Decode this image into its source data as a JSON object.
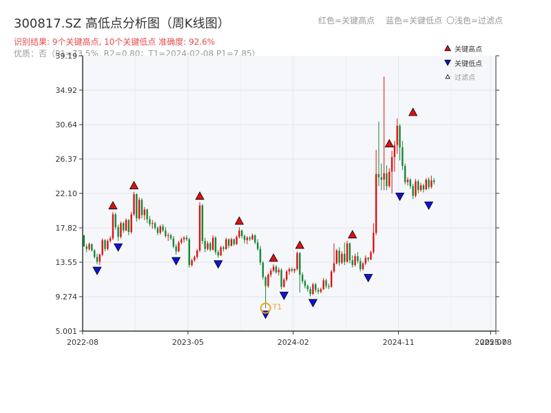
{
  "header": {
    "title": "300817.SZ 高低点分析图（周K线图）",
    "subtitle": "识别结果: 9个关键高点, 10个关键低点  准确度: 92.6%",
    "subtitle2": "优质：否（P1=73.5%, R2=0.80；T1=2024-02-08 P1=7.85）"
  },
  "top_legend": {
    "high_label": "红色=关键高点",
    "low_label": "蓝色=关键低点",
    "filtered_label": "〇浅色=过滤点"
  },
  "chart_data": {
    "type": "candlestick",
    "y_ticks": [
      "5.001",
      "9.274",
      "13.55",
      "17.82",
      "22.10",
      "26.37",
      "30.64",
      "34.92",
      "39.19"
    ],
    "ylim": [
      5.001,
      39.19
    ],
    "x_ticks": [
      {
        "date": "2022-08",
        "week": 0
      },
      {
        "date": "2023-05",
        "week": 40
      },
      {
        "date": "2024-02",
        "week": 80
      },
      {
        "date": "2024-11",
        "week": 120
      },
      {
        "date": "2025-07",
        "week": 155
      },
      {
        "date": "2025-08",
        "week": 157
      }
    ],
    "legend": [
      {
        "label": "关键高点",
        "color": "#dd1111",
        "shape": "up"
      },
      {
        "label": "关键低点",
        "color": "#1111dd",
        "shape": "down"
      },
      {
        "label": "过滤点",
        "color": "#ffffff",
        "shape": "up-small"
      }
    ],
    "candles_ohlc": [
      [
        16.9,
        16.9,
        15.5,
        15.5
      ],
      [
        15.5,
        15.8,
        14.8,
        15.2
      ],
      [
        15.2,
        16.0,
        15.0,
        15.8
      ],
      [
        15.8,
        15.9,
        14.9,
        15.0
      ],
      [
        15.0,
        15.2,
        14.0,
        14.2
      ],
      [
        14.2,
        14.6,
        13.3,
        13.6
      ],
      [
        13.6,
        14.6,
        13.2,
        14.5
      ],
      [
        14.5,
        16.5,
        14.3,
        16.3
      ],
      [
        16.3,
        16.4,
        14.9,
        15.2
      ],
      [
        15.2,
        16.4,
        15.0,
        16.2
      ],
      [
        16.2,
        16.8,
        16.0,
        16.5
      ],
      [
        16.5,
        19.8,
        16.3,
        19.5
      ],
      [
        19.5,
        19.7,
        17.6,
        17.9
      ],
      [
        17.9,
        18.2,
        16.2,
        16.7
      ],
      [
        16.7,
        18.6,
        16.5,
        18.4
      ],
      [
        18.4,
        18.6,
        17.2,
        17.5
      ],
      [
        17.5,
        19.0,
        17.4,
        18.8
      ],
      [
        18.8,
        18.9,
        16.9,
        17.3
      ],
      [
        17.3,
        19.8,
        17.1,
        19.5
      ],
      [
        19.5,
        22.3,
        19.3,
        22.0
      ],
      [
        22.0,
        22.1,
        18.6,
        19.0
      ],
      [
        19.0,
        21.6,
        18.8,
        21.3
      ],
      [
        21.3,
        21.5,
        19.0,
        19.4
      ],
      [
        19.4,
        20.4,
        18.8,
        20.1
      ],
      [
        20.1,
        20.2,
        18.4,
        18.9
      ],
      [
        18.9,
        19.3,
        18.0,
        18.3
      ],
      [
        18.3,
        18.8,
        17.7,
        18.4
      ],
      [
        18.4,
        18.6,
        17.6,
        17.8
      ],
      [
        17.8,
        18.0,
        16.9,
        17.2
      ],
      [
        17.2,
        18.2,
        17.0,
        18.0
      ],
      [
        18.0,
        18.3,
        17.3,
        17.5
      ],
      [
        17.5,
        17.9,
        16.6,
        16.8
      ],
      [
        16.8,
        17.2,
        16.2,
        16.9
      ],
      [
        16.9,
        17.1,
        16.3,
        16.5
      ],
      [
        16.5,
        16.8,
        15.3,
        15.5
      ],
      [
        15.5,
        15.8,
        14.5,
        14.9
      ],
      [
        14.9,
        16.2,
        14.8,
        16.0
      ],
      [
        16.0,
        16.6,
        15.8,
        16.4
      ],
      [
        16.4,
        16.8,
        16.0,
        16.6
      ],
      [
        16.6,
        16.9,
        16.2,
        16.4
      ],
      [
        16.4,
        16.6,
        12.9,
        13.2
      ],
      [
        13.2,
        14.0,
        13.0,
        13.8
      ],
      [
        13.8,
        14.4,
        13.6,
        14.2
      ],
      [
        14.2,
        15.2,
        14.0,
        15.0
      ],
      [
        15.0,
        21.0,
        14.8,
        20.6
      ],
      [
        20.6,
        20.8,
        15.8,
        16.2
      ],
      [
        16.2,
        16.6,
        14.8,
        15.2
      ],
      [
        15.2,
        16.2,
        15.0,
        15.9
      ],
      [
        15.9,
        16.1,
        14.9,
        15.1
      ],
      [
        15.1,
        16.9,
        15.0,
        16.6
      ],
      [
        16.6,
        16.8,
        14.5,
        14.8
      ],
      [
        14.8,
        15.1,
        14.1,
        14.4
      ],
      [
        14.4,
        15.6,
        14.3,
        15.4
      ],
      [
        15.4,
        15.6,
        14.9,
        15.2
      ],
      [
        15.2,
        16.6,
        15.1,
        16.4
      ],
      [
        16.4,
        16.5,
        15.3,
        15.6
      ],
      [
        15.6,
        16.6,
        15.5,
        16.4
      ],
      [
        16.4,
        16.5,
        15.6,
        15.8
      ],
      [
        15.8,
        16.9,
        15.7,
        16.7
      ],
      [
        16.7,
        17.9,
        16.5,
        17.5
      ],
      [
        17.5,
        17.6,
        16.5,
        16.8
      ],
      [
        16.8,
        17.0,
        15.9,
        16.3
      ],
      [
        16.3,
        16.8,
        15.8,
        16.6
      ],
      [
        16.6,
        16.8,
        16.2,
        16.4
      ],
      [
        16.4,
        17.1,
        16.3,
        16.9
      ],
      [
        16.9,
        17.0,
        15.8,
        16.0
      ],
      [
        16.0,
        16.4,
        15.0,
        15.2
      ],
      [
        15.2,
        15.6,
        13.2,
        13.5
      ],
      [
        13.5,
        13.7,
        11.4,
        11.7
      ],
      [
        11.7,
        11.8,
        7.85,
        10.6
      ],
      [
        10.6,
        12.2,
        10.4,
        12.0
      ],
      [
        12.0,
        12.8,
        11.7,
        12.5
      ],
      [
        12.5,
        13.3,
        12.3,
        13.0
      ],
      [
        13.0,
        13.2,
        12.1,
        12.3
      ],
      [
        12.3,
        12.9,
        11.9,
        12.6
      ],
      [
        12.6,
        12.8,
        10.2,
        10.5
      ],
      [
        10.5,
        11.6,
        10.4,
        11.4
      ],
      [
        11.4,
        12.6,
        11.2,
        12.4
      ],
      [
        12.4,
        12.9,
        12.0,
        12.7
      ],
      [
        12.7,
        12.9,
        12.3,
        12.5
      ],
      [
        12.5,
        12.8,
        12.2,
        12.7
      ],
      [
        12.7,
        14.9,
        12.5,
        14.7
      ],
      [
        14.7,
        14.8,
        9.8,
        12.0
      ],
      [
        12.0,
        12.3,
        10.9,
        11.2
      ],
      [
        11.2,
        11.4,
        10.3,
        10.6
      ],
      [
        10.6,
        10.8,
        9.9,
        10.2
      ],
      [
        10.2,
        10.5,
        9.3,
        9.6
      ],
      [
        9.6,
        11.0,
        9.5,
        10.8
      ],
      [
        10.8,
        11.0,
        9.8,
        10.1
      ],
      [
        10.1,
        10.4,
        9.6,
        9.9
      ],
      [
        9.9,
        10.4,
        9.7,
        10.2
      ],
      [
        10.2,
        11.6,
        10.1,
        11.3
      ],
      [
        11.3,
        11.5,
        10.3,
        10.6
      ],
      [
        10.6,
        10.9,
        10.2,
        10.5
      ],
      [
        10.5,
        12.6,
        10.4,
        12.4
      ],
      [
        12.4,
        15.9,
        12.2,
        13.4
      ],
      [
        13.4,
        15.2,
        13.3,
        15.0
      ],
      [
        15.0,
        15.4,
        13.1,
        13.5
      ],
      [
        13.5,
        14.9,
        13.3,
        14.6
      ],
      [
        14.6,
        16.0,
        13.2,
        13.6
      ],
      [
        13.6,
        16.2,
        13.5,
        15.9
      ],
      [
        15.9,
        16.0,
        13.4,
        13.8
      ],
      [
        13.8,
        14.4,
        12.9,
        13.2
      ],
      [
        13.2,
        14.6,
        13.0,
        14.3
      ],
      [
        14.3,
        14.8,
        13.4,
        13.7
      ],
      [
        13.7,
        14.1,
        12.4,
        12.7
      ],
      [
        12.7,
        13.6,
        12.5,
        13.4
      ],
      [
        13.4,
        14.4,
        13.2,
        14.1
      ],
      [
        14.1,
        14.2,
        13.6,
        13.9
      ],
      [
        13.9,
        15.0,
        13.8,
        14.8
      ],
      [
        14.8,
        18.4,
        14.6,
        17.2
      ],
      [
        17.2,
        27.5,
        16.9,
        24.5
      ],
      [
        24.5,
        31.0,
        23.0,
        24.1
      ],
      [
        24.1,
        25.8,
        22.5,
        23.8
      ],
      [
        23.8,
        36.6,
        22.5,
        24.6
      ],
      [
        24.6,
        25.6,
        22.5,
        23.0
      ],
      [
        23.0,
        25.2,
        22.8,
        24.8
      ],
      [
        24.8,
        27.4,
        22.1,
        26.6
      ],
      [
        26.6,
        28.6,
        24.8,
        28.1
      ],
      [
        28.1,
        31.4,
        27.0,
        30.5
      ],
      [
        30.5,
        30.7,
        26.2,
        27.8
      ],
      [
        27.8,
        28.6,
        25.0,
        25.5
      ],
      [
        25.5,
        25.8,
        23.2,
        23.5
      ],
      [
        23.5,
        24.1,
        23.1,
        23.8
      ],
      [
        23.8,
        24.0,
        22.7,
        23.0
      ],
      [
        23.0,
        23.3,
        21.4,
        21.8
      ],
      [
        21.8,
        23.9,
        21.6,
        23.6
      ],
      [
        23.6,
        23.8,
        22.1,
        22.5
      ],
      [
        22.5,
        23.4,
        22.3,
        23.1
      ],
      [
        23.1,
        23.3,
        22.2,
        22.6
      ],
      [
        22.6,
        24.0,
        22.5,
        23.8
      ],
      [
        23.8,
        24.1,
        22.6,
        22.9
      ],
      [
        22.9,
        24.3,
        22.7,
        23.7
      ],
      [
        23.7,
        24.0,
        23.2,
        23.5
      ]
    ],
    "key_highs": [
      {
        "index": 11,
        "price": 19.8
      },
      {
        "index": 19,
        "price": 22.3
      },
      {
        "index": 44,
        "price": 21.0
      },
      {
        "index": 59,
        "price": 17.9
      },
      {
        "index": 72,
        "price": 13.3
      },
      {
        "index": 82,
        "price": 14.9
      },
      {
        "index": 102,
        "price": 16.2
      },
      {
        "index": 116,
        "price": 27.5
      },
      {
        "index": 125,
        "price": 31.4
      }
    ],
    "key_lows": [
      {
        "index": 5,
        "price": 13.3
      },
      {
        "index": 13,
        "price": 16.2
      },
      {
        "index": 35,
        "price": 14.5
      },
      {
        "index": 51,
        "price": 14.1
      },
      {
        "index": 69,
        "price": 7.85
      },
      {
        "index": 76,
        "price": 10.2
      },
      {
        "index": 87,
        "price": 9.3
      },
      {
        "index": 108,
        "price": 12.4
      },
      {
        "index": 120,
        "price": 22.5
      },
      {
        "index": 131,
        "price": 21.4
      }
    ],
    "t1": {
      "index": 69,
      "price": 7.85,
      "label": "T1"
    }
  }
}
